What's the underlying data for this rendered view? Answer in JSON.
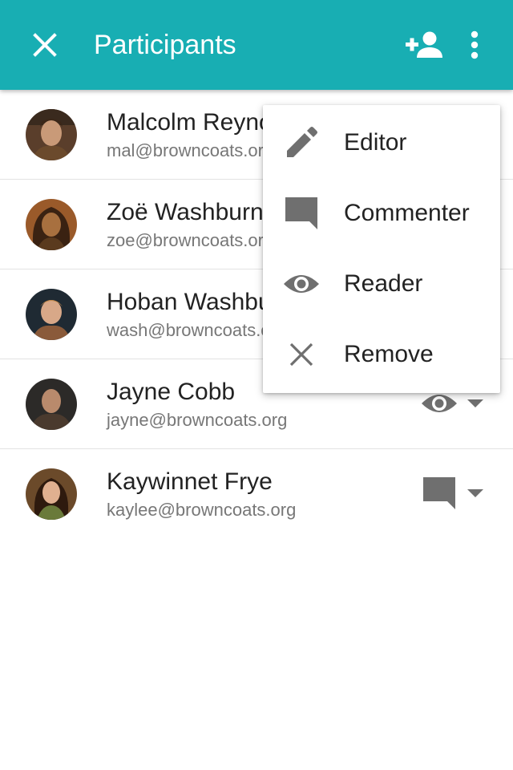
{
  "appbar": {
    "title": "Participants",
    "close_icon": "close-icon",
    "add_icon": "person-add-icon",
    "more_icon": "more-vert-icon",
    "color": "#18aeb3"
  },
  "participants": [
    {
      "name": "Malcolm Reynolds",
      "email": "mal@browncoats.org",
      "role": "editor"
    },
    {
      "name": "Zoë Washburne",
      "email": "zoe@browncoats.org",
      "role": "editor"
    },
    {
      "name": "Hoban Washburne",
      "email": "wash@browncoats.org",
      "role": "editor"
    },
    {
      "name": "Jayne Cobb",
      "email": "jayne@browncoats.org",
      "role": "reader",
      "role_icon": "eye-icon"
    },
    {
      "name": "Kaywinnet Frye",
      "email": "kaylee@browncoats.org",
      "role": "commenter",
      "role_icon": "comment-icon"
    }
  ],
  "role_menu": {
    "items": [
      {
        "label": "Editor",
        "icon": "pencil-icon"
      },
      {
        "label": "Commenter",
        "icon": "comment-icon"
      },
      {
        "label": "Reader",
        "icon": "eye-icon"
      },
      {
        "label": "Remove",
        "icon": "close-icon"
      }
    ]
  }
}
